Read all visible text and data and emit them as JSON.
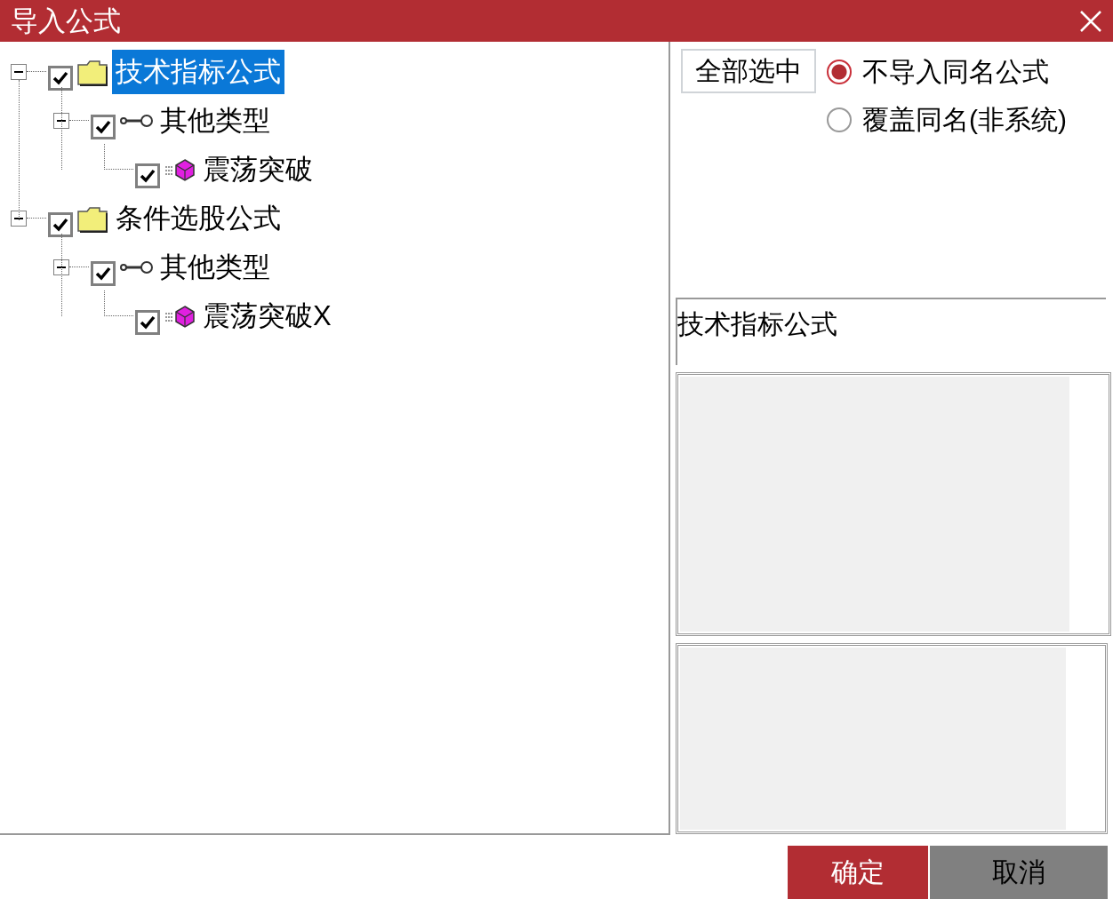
{
  "window": {
    "title": "导入公式"
  },
  "tree": [
    {
      "label": "技术指标公式",
      "kind": "folder",
      "checked": true,
      "expanded": true,
      "selected": true,
      "children": [
        {
          "label": "其他类型",
          "kind": "category",
          "checked": true,
          "expanded": true,
          "selected": false,
          "children": [
            {
              "label": "震荡突破",
              "kind": "formula",
              "checked": true,
              "selected": false
            }
          ]
        }
      ]
    },
    {
      "label": "条件选股公式",
      "kind": "folder",
      "checked": true,
      "expanded": true,
      "selected": false,
      "children": [
        {
          "label": "其他类型",
          "kind": "category",
          "checked": true,
          "expanded": true,
          "selected": false,
          "children": [
            {
              "label": "震荡突破X",
              "kind": "formula",
              "checked": true,
              "selected": false
            }
          ]
        }
      ]
    }
  ],
  "select_all_button": "全部选中",
  "options": [
    {
      "label": "不导入同名公式",
      "selected": true
    },
    {
      "label": "覆盖同名(非系统)",
      "selected": false
    }
  ],
  "name_field": {
    "value": "技术指标公式"
  },
  "buttons": [
    {
      "label": "确定",
      "kind": "primary"
    },
    {
      "label": "取消",
      "kind": "secondary"
    }
  ]
}
